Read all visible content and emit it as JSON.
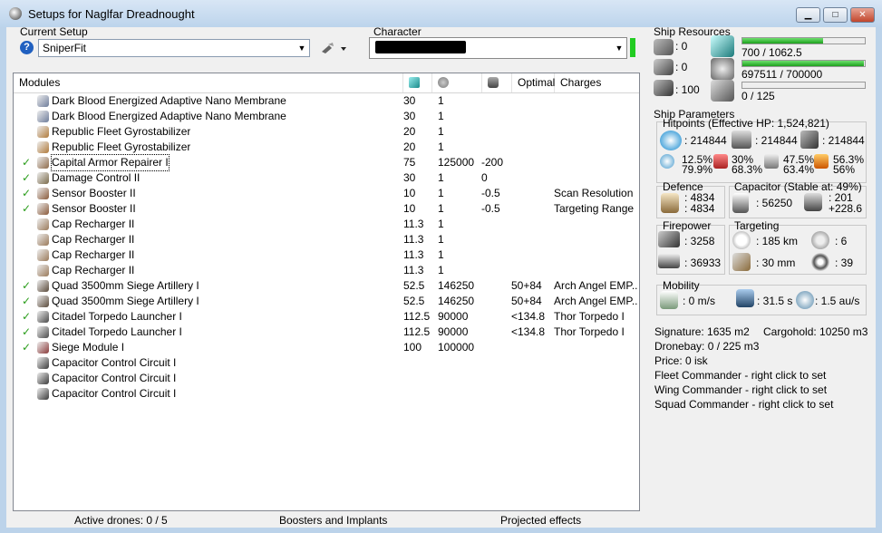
{
  "window": {
    "title": "Setups for Naglfar Dreadnought",
    "min": "▁",
    "max": "□",
    "close": "✕"
  },
  "setup": {
    "label": "Current Setup",
    "value": "SniperFit",
    "help": "?"
  },
  "character": {
    "label": "Character",
    "value": ""
  },
  "modules": {
    "headers": {
      "name": "Modules",
      "optimal": "Optimal",
      "charges": "Charges"
    },
    "rows": [
      {
        "name": "Dark Blood Energized Adaptive Nano Membrane",
        "cpu": "30",
        "pg": "1",
        "cap": "",
        "optimal": "",
        "charges": "",
        "active": false,
        "color": "#6d7c9a"
      },
      {
        "name": "Dark Blood Energized Adaptive Nano Membrane",
        "cpu": "30",
        "pg": "1",
        "cap": "",
        "optimal": "",
        "charges": "",
        "active": false,
        "color": "#6d7c9a"
      },
      {
        "name": "Republic Fleet Gyrostabilizer",
        "cpu": "20",
        "pg": "1",
        "cap": "",
        "optimal": "",
        "charges": "",
        "active": false,
        "color": "#b07a3a"
      },
      {
        "name": "Republic Fleet Gyrostabilizer",
        "cpu": "20",
        "pg": "1",
        "cap": "",
        "optimal": "",
        "charges": "",
        "active": false,
        "color": "#b07a3a"
      },
      {
        "name": "Capital Armor Repairer I",
        "cpu": "75",
        "pg": "125000",
        "cap": "-200",
        "optimal": "",
        "charges": "",
        "active": true,
        "color": "#8e6a4a"
      },
      {
        "name": "Damage Control II",
        "cpu": "30",
        "pg": "1",
        "cap": "0",
        "optimal": "",
        "charges": "",
        "active": true,
        "color": "#7a6a4a"
      },
      {
        "name": "Sensor Booster II",
        "cpu": "10",
        "pg": "1",
        "cap": "-0.5",
        "optimal": "",
        "charges": "Scan Resolution",
        "active": true,
        "color": "#8a5a3a"
      },
      {
        "name": "Sensor Booster II",
        "cpu": "10",
        "pg": "1",
        "cap": "-0.5",
        "optimal": "",
        "charges": "Targeting Range",
        "active": true,
        "color": "#8a5a3a"
      },
      {
        "name": "Cap Recharger II",
        "cpu": "11.3",
        "pg": "1",
        "cap": "",
        "optimal": "",
        "charges": "",
        "active": false,
        "color": "#9a7a5a"
      },
      {
        "name": "Cap Recharger II",
        "cpu": "11.3",
        "pg": "1",
        "cap": "",
        "optimal": "",
        "charges": "",
        "active": false,
        "color": "#9a7a5a"
      },
      {
        "name": "Cap Recharger II",
        "cpu": "11.3",
        "pg": "1",
        "cap": "",
        "optimal": "",
        "charges": "",
        "active": false,
        "color": "#9a7a5a"
      },
      {
        "name": "Cap Recharger II",
        "cpu": "11.3",
        "pg": "1",
        "cap": "",
        "optimal": "",
        "charges": "",
        "active": false,
        "color": "#9a7a5a"
      },
      {
        "name": "Quad 3500mm Siege Artillery I",
        "cpu": "52.5",
        "pg": "146250",
        "cap": "",
        "optimal": "50+84",
        "charges": "Arch Angel EMP...",
        "active": true,
        "color": "#5a4a3a"
      },
      {
        "name": "Quad 3500mm Siege Artillery I",
        "cpu": "52.5",
        "pg": "146250",
        "cap": "",
        "optimal": "50+84",
        "charges": "Arch Angel EMP...",
        "active": true,
        "color": "#5a4a3a"
      },
      {
        "name": "Citadel Torpedo Launcher I",
        "cpu": "112.5",
        "pg": "90000",
        "cap": "",
        "optimal": "<134.8",
        "charges": "Thor Torpedo I",
        "active": true,
        "color": "#4a4a4a"
      },
      {
        "name": "Citadel Torpedo Launcher I",
        "cpu": "112.5",
        "pg": "90000",
        "cap": "",
        "optimal": "<134.8",
        "charges": "Thor Torpedo I",
        "active": true,
        "color": "#4a4a4a"
      },
      {
        "name": "Siege Module I",
        "cpu": "100",
        "pg": "100000",
        "cap": "",
        "optimal": "",
        "charges": "",
        "active": true,
        "color": "#8a3a3a"
      },
      {
        "name": "Capacitor Control Circuit I",
        "cpu": "",
        "pg": "",
        "cap": "",
        "optimal": "",
        "charges": "",
        "active": false,
        "color": "#3a3a3a"
      },
      {
        "name": "Capacitor Control Circuit I",
        "cpu": "",
        "pg": "",
        "cap": "",
        "optimal": "",
        "charges": "",
        "active": false,
        "color": "#3a3a3a"
      },
      {
        "name": "Capacitor Control Circuit I",
        "cpu": "",
        "pg": "",
        "cap": "",
        "optimal": "",
        "charges": "",
        "active": false,
        "color": "#3a3a3a"
      }
    ]
  },
  "status": {
    "drones": "Active drones: 0 / 5",
    "boosters": "Boosters and Implants",
    "projected": "Projected effects"
  },
  "resources": {
    "label": "Ship Resources",
    "turrets": ": 0",
    "launchers": ": 0",
    "calibration": ": 100",
    "cpu": {
      "text": "700 / 1062.5",
      "fill": 0.66
    },
    "pg": {
      "text": "697511 / 700000",
      "fill": 0.996
    },
    "drones": {
      "text": "0 / 125",
      "fill": 0
    }
  },
  "params": {
    "label": "Ship Parameters",
    "hp_label": "Hitpoints (Effective HP: 1,524,821)",
    "shield_hp": ": 214844",
    "armor_hp": ": 214844",
    "hull_hp": ": 214844",
    "res": {
      "em1": "12.5%",
      "em2": "79.9%",
      "th1": "30%",
      "th2": "68.3%",
      "ki1": "47.5%",
      "ki2": "63.4%",
      "ex1": "56.3%",
      "ex2": "56%"
    },
    "defence_label": "Defence",
    "def1": ": 4834",
    "def2": ": 4834",
    "cap_label": "Capacitor (Stable at: 49%)",
    "cap_amount": ": 56250",
    "cap_a": ": 201",
    "cap_b": "+228.6",
    "fire_label": "Firepower",
    "fire1": ": 3258",
    "fire2": ": 36933",
    "target_label": "Targeting",
    "t_range": ": 185 km",
    "t_max": ": 6",
    "t_res": ": 30 mm",
    "t_sens": ": 39",
    "mob_label": "Mobility",
    "speed": ": 0 m/s",
    "align": ": 31.5 s",
    "warp": ": 1.5 au/s",
    "signature": "Signature: 1635 m2",
    "cargo": "Cargohold: 10250 m3",
    "dronebay": "Dronebay: 0 / 225 m3",
    "price": "Price: 0 isk",
    "fleet": "Fleet Commander - right click to set",
    "wing": "Wing Commander - right click to set",
    "squad": "Squad Commander - right click to set"
  },
  "colors": {
    "check": "#2a9d1a",
    "bar": "#1da01d",
    "charbar": "#22cc22"
  }
}
